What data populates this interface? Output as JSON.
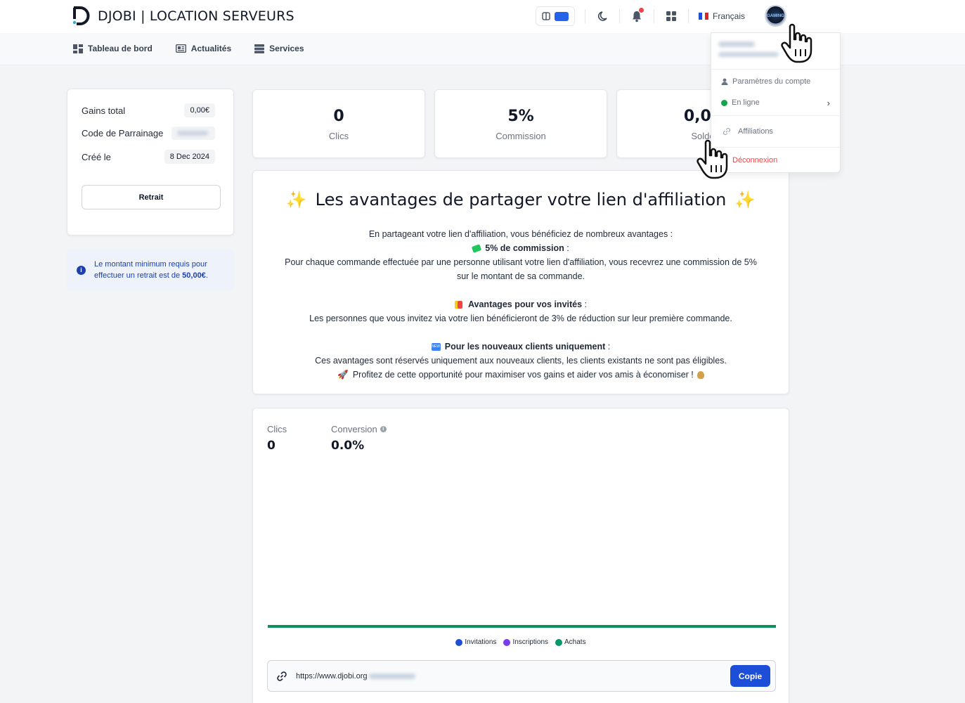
{
  "brand": {
    "title": "DJOBI | LOCATION SERVEURS"
  },
  "topbar": {
    "language": "Français",
    "icons": [
      "theme-toggle-icon",
      "moon-icon",
      "bell-icon",
      "grid-icon",
      "france-flag-icon",
      "avatar"
    ]
  },
  "subnav": {
    "items": [
      {
        "label": "Tableau de bord",
        "icon": "dashboard-icon"
      },
      {
        "label": "Actualités",
        "icon": "news-icon"
      },
      {
        "label": "Services",
        "icon": "server-icon"
      }
    ]
  },
  "info_card": {
    "gains_label": "Gains total",
    "gains_value": "0,00€",
    "referral_label": "Code de Parrainage",
    "created_label": "Créé le",
    "created_value": "8 Dec 2024",
    "withdraw_button": "Retrait"
  },
  "notice": {
    "text": "Le montant minimum requis pour effectuer un retrait est de ",
    "amount": "50,00€",
    "end": "."
  },
  "stats": [
    {
      "value": "0",
      "label": "Clics"
    },
    {
      "value": "5%",
      "label": "Commission"
    },
    {
      "value": "0,00",
      "label": "Solde"
    }
  ],
  "advantages": {
    "title": "Les avantages de partager votre lien d'affiliation",
    "intro": "En partageant votre lien d'affiliation, vous bénéficiez de nombreux avantages :",
    "commission_heading": "5% de commission",
    "commission_text_1": "Pour chaque commande effectuée par une personne utilisant votre lien d'affiliation, vous recevrez une commission de 5%",
    "commission_text_2": "sur le montant de sa commande.",
    "invites_heading": "Avantages pour vos invités",
    "invites_text": "Les personnes que vous invitez via votre lien bénéficieront de 3% de réduction sur leur première commande.",
    "new_heading": "Pour les nouveaux clients uniquement",
    "new_text": "Ces avantages sont réservés uniquement aux nouveaux clients, les clients existants ne sont pas éligibles.",
    "closing": "Profitez de cette opportunité pour maximiser vos gains et aider vos amis à économiser !",
    "colon": " :"
  },
  "metrics": {
    "clicks_label": "Clics",
    "clicks_value": "0",
    "conversion_label": "Conversion",
    "conversion_value": "0.0%"
  },
  "legend": [
    {
      "label": "Invitations",
      "color": "#1d4ed8"
    },
    {
      "label": "Inscriptions",
      "color": "#7c3aed"
    },
    {
      "label": "Achats",
      "color": "#059669"
    }
  ],
  "affiliate_link": {
    "url": "https://www.djobi.org",
    "copy_button": "Copie"
  },
  "dropdown": {
    "account_settings": "Paramètres du compte",
    "status": "En ligne",
    "affiliations": "Affiliations",
    "logout": "Déconnexion"
  },
  "colors": {
    "accent": "#1d4ed8",
    "chart_line": "#0e8f5c",
    "status_online": "#16a34a",
    "logout": "#ef4444"
  }
}
